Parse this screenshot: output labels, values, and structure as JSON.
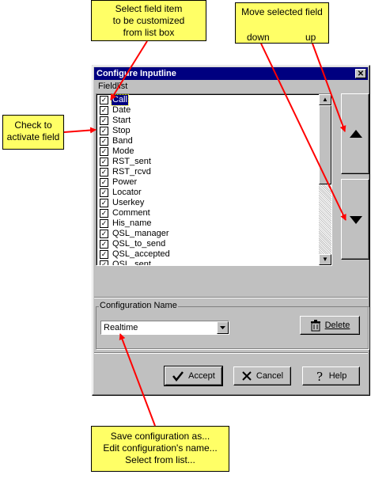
{
  "callouts": {
    "select_item": [
      "Select field item",
      "to be customized",
      "from list box"
    ],
    "move_field": {
      "title": "Move selected field",
      "down": "down",
      "up": "up"
    },
    "check_activate": [
      "Check to",
      "activate field"
    ],
    "save_config": [
      "Save configuration as...",
      "Edit configuration's name...",
      "Select from list..."
    ]
  },
  "dialog": {
    "title": "Configure Inputline",
    "close_glyph": "✕",
    "fieldlist_label": "Fieldlist",
    "fields": [
      {
        "label": "Call",
        "checked": true,
        "selected": true
      },
      {
        "label": "Date",
        "checked": true
      },
      {
        "label": "Start",
        "checked": true
      },
      {
        "label": "Stop",
        "checked": true
      },
      {
        "label": "Band",
        "checked": true
      },
      {
        "label": "Mode",
        "checked": true
      },
      {
        "label": "RST_sent",
        "checked": true
      },
      {
        "label": "RST_rcvd",
        "checked": true
      },
      {
        "label": "Power",
        "checked": true
      },
      {
        "label": "Locator",
        "checked": true
      },
      {
        "label": "Userkey",
        "checked": true
      },
      {
        "label": "Comment",
        "checked": true
      },
      {
        "label": "His_name",
        "checked": true
      },
      {
        "label": "QSL_manager",
        "checked": true
      },
      {
        "label": "QSL_to_send",
        "checked": true
      },
      {
        "label": "QSL_accepted",
        "checked": true
      },
      {
        "label": "QSL_sent",
        "checked": true
      }
    ],
    "config_group_label": "Configuration Name",
    "config_name_value": "Realtime",
    "delete_label": "Delete",
    "accept_label": "Accept",
    "cancel_label": "Cancel",
    "help_label": "Help",
    "icons": {
      "close": "close-icon",
      "move_up": "triangle-up-icon",
      "move_down": "triangle-down-icon",
      "delete": "trash-icon",
      "accept": "checkmark-icon",
      "cancel": "x-icon",
      "help": "question-mark-icon"
    }
  },
  "colors": {
    "callout": "#ffff66",
    "arrow": "#ff0000",
    "titlebar": "#000080",
    "face": "#c0c0c0"
  }
}
